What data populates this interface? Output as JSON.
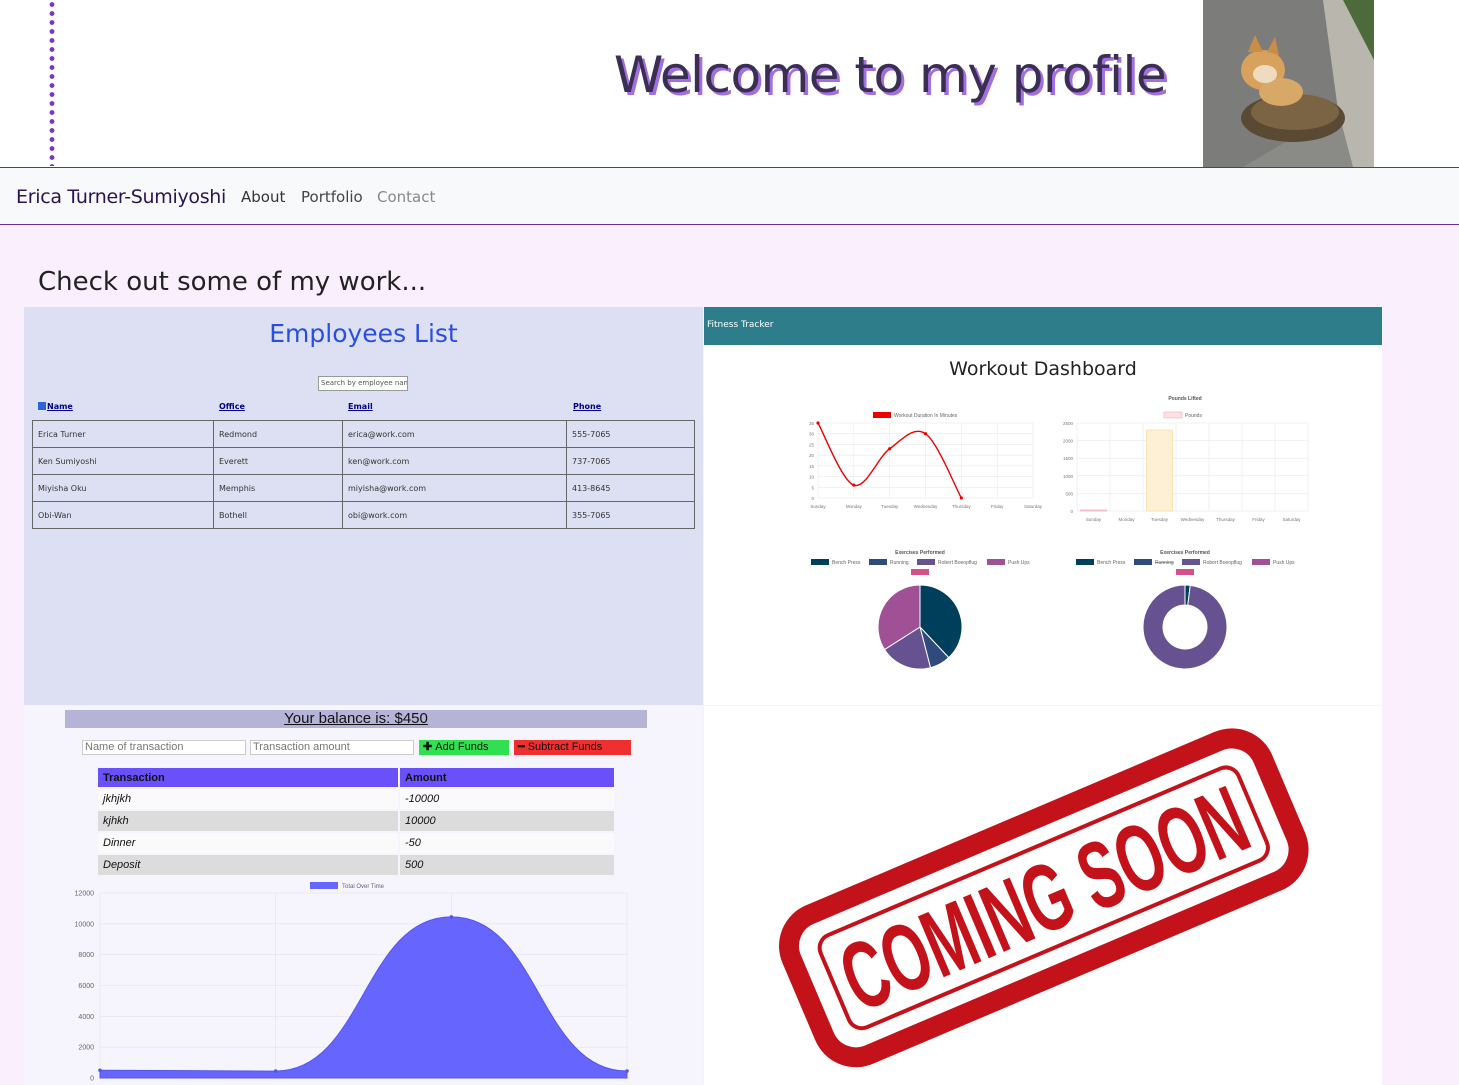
{
  "header": {
    "title": "Welcome to my profile"
  },
  "nav": {
    "brand": "Erica Turner-Sumiyoshi",
    "links": [
      "About",
      "Portfolio",
      "Contact"
    ]
  },
  "section": {
    "title": "Check out some of my work..."
  },
  "employees": {
    "title": "Employees List",
    "search_placeholder": "Search by employee name",
    "columns": [
      "Name",
      "Office",
      "Email",
      "Phone"
    ],
    "rows": [
      [
        "Erica Turner",
        "Redmond",
        "erica@work.com",
        "555-7065"
      ],
      [
        "Ken Sumiyoshi",
        "Everett",
        "ken@work.com",
        "737-7065"
      ],
      [
        "Miyisha Oku",
        "Memphis",
        "miyisha@work.com",
        "413-8645"
      ],
      [
        "Obi-Wan",
        "Bothell",
        "obi@work.com",
        "355-7065"
      ]
    ]
  },
  "fitness": {
    "app_name": "Fitness Tracker",
    "title": "Workout Dashboard",
    "line_legend": "Workout Duration In Minutes",
    "bar_title": "Pounds Lifted",
    "bar_legend": "Pounds",
    "pie_title": "Exercises Performed",
    "donut_title": "Exercises Performed",
    "days": [
      "Sunday",
      "Monday",
      "Tuesday",
      "Wednesday",
      "Thursday",
      "Friday",
      "Saturday"
    ],
    "exercises": [
      "Bench Press",
      "Running",
      "Robert Boeopflug",
      "Push Ups"
    ],
    "colors": [
      "#003f5c",
      "#2f4b7c",
      "#665191",
      "#a05195",
      "#d45087"
    ]
  },
  "budget": {
    "balance_text": "Your balance is: $450",
    "name_placeholder": "Name of transaction",
    "amount_placeholder": "Transaction amount",
    "add_label": "Add Funds",
    "subtract_label": "Subtract Funds",
    "columns": [
      "Transaction",
      "Amount"
    ],
    "rows": [
      [
        "jkhjkh",
        "-10000"
      ],
      [
        "kjhkh",
        "10000"
      ],
      [
        "Dinner",
        "-50"
      ],
      [
        "Deposit",
        "500"
      ]
    ],
    "chart_legend": "Total Over Time"
  },
  "coming_soon": {
    "stamp_text": "COMING SOON"
  },
  "chart_data": [
    {
      "type": "line",
      "title": "",
      "series": [
        {
          "name": "Workout Duration In Minutes",
          "values": [
            35,
            6,
            23,
            30,
            0,
            null,
            null
          ]
        }
      ],
      "categories": [
        "Sunday",
        "Monday",
        "Tuesday",
        "Wednesday",
        "Thursday",
        "Friday",
        "Saturday"
      ],
      "ylim": [
        0,
        35
      ],
      "yticks": [
        0,
        5,
        10,
        15,
        20,
        25,
        30,
        35
      ]
    },
    {
      "type": "bar",
      "title": "Pounds Lifted",
      "series": [
        {
          "name": "Pounds",
          "values": [
            30,
            0,
            2300,
            0,
            0,
            0,
            0
          ]
        }
      ],
      "categories": [
        "Sunday",
        "Monday",
        "Tuesday",
        "Wednesday",
        "Thursday",
        "Friday",
        "Saturday"
      ],
      "ylim": [
        0,
        2500
      ],
      "yticks": [
        0,
        500,
        1000,
        1500,
        2000,
        2500
      ]
    },
    {
      "type": "pie",
      "title": "Exercises Performed",
      "categories": [
        "Bench Press",
        "Running",
        "Robert Boeopflug",
        "Push Ups"
      ],
      "values": [
        38,
        8,
        20,
        34
      ]
    },
    {
      "type": "pie",
      "title": "Exercises Performed",
      "categories": [
        "Bench Press",
        "Robert Boeopflug"
      ],
      "values": [
        2,
        98
      ]
    },
    {
      "type": "area",
      "series": [
        {
          "name": "Total Over Time",
          "values": [
            500,
            450,
            10450,
            450
          ]
        }
      ],
      "ylim": [
        0,
        12000
      ],
      "yticks": [
        0,
        2000,
        4000,
        6000,
        8000,
        10000,
        12000
      ]
    }
  ]
}
